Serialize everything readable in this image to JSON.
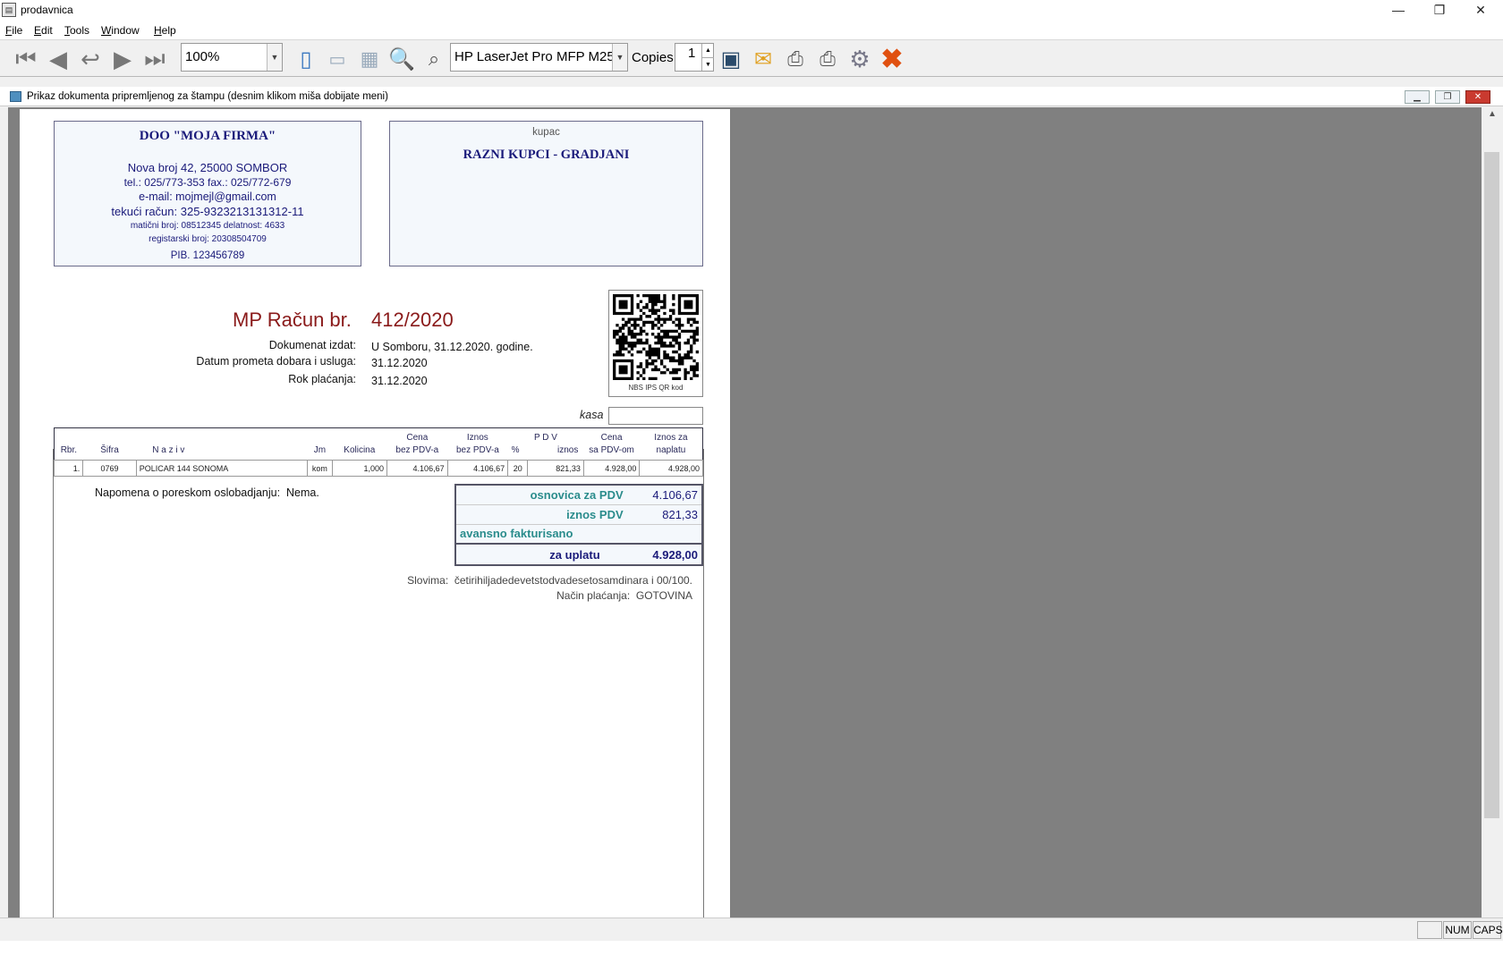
{
  "window": {
    "title": "prodavnica",
    "controls": {
      "minimize": "—",
      "restore": "❐",
      "close": "✕"
    }
  },
  "menu": [
    "File",
    "Edit",
    "Tools",
    "Window",
    "Help"
  ],
  "toolbar": {
    "zoom": "100%",
    "printer": "HP LaserJet Pro MFP M25-",
    "copies_label": "Copies",
    "copies_value": "1"
  },
  "doc_window": {
    "title": "Prikaz dokumenta pripremljenog za štampu  (desnim klikom miša dobijate meni)"
  },
  "seller": {
    "name": "DOO  \"MOJA FIRMA\"",
    "address": "Nova broj 42, 25000 SOMBOR",
    "phone": "tel.: 025/773-353  fax.: 025/772-679",
    "email": "e-mail: mojmejl@gmail.com",
    "account": "tekući račun:   325-9323213131312-11",
    "ids": "matični broj: 08512345  delatnost: 4633",
    "register": "registarski broj: 20308504709",
    "pib": "PIB. 123456789"
  },
  "buyer": {
    "label": "kupac",
    "name": "RAZNI KUPCI - GRADJANI"
  },
  "invoice": {
    "title": "MP Račun  br.",
    "number": "412/2020",
    "issued_label": "Dokumenat izdat:",
    "issued_value": "U Somboru, 31.12.2020. godine.",
    "turnover_label": "Datum prometa dobara i usluga:",
    "turnover_value": "31.12.2020",
    "due_label": "Rok plaćanja:",
    "due_value": "31.12.2020",
    "qr_caption": "NBS  IPS QR kod",
    "kasa_label": "kasa"
  },
  "table": {
    "headers": {
      "rbr": "Rbr.",
      "sifra": "Šifra",
      "naziv": "N a z i v",
      "jm": "Jm",
      "kolicina": "Kolicina",
      "cena1": "Cena",
      "cena2": "bez PDV-a",
      "iznos1": "Iznos",
      "iznos2": "bez PDV-a",
      "pdv": "P D V",
      "pdv_pct": "%",
      "pdv_iznos": "iznos",
      "cena_pdv1": "Cena",
      "cena_pdv2": "sa PDV-om",
      "naplata1": "Iznos za",
      "naplata2": "naplatu"
    },
    "rows": [
      {
        "rbr": "1.",
        "sifra": "0769",
        "naziv": "POLICAR 144 SONOMA",
        "jm": "kom",
        "kolicina": "1,000",
        "cena": "4.106,67",
        "iznos": "4.106,67",
        "pdv_pct": "20",
        "pdv_iznos": "821,33",
        "cena_pdv": "4.928,00",
        "naplata": "4.928,00"
      }
    ]
  },
  "note_label": "Napomena o poreskom oslobadjanju:",
  "note_value": "Nema.",
  "totals": {
    "osnovica_label": "osnovica za PDV",
    "osnovica_value": "4.106,67",
    "pdv_label": "iznos PDV",
    "pdv_value": "821,33",
    "avans_label": "avansno fakturisano",
    "uplata_label": "za uplatu",
    "uplata_value": "4.928,00"
  },
  "slovima_label": "Slovima:",
  "slovima_value": "četirihiljadedevetstodvadesetosamdinara i 00/100.",
  "nacin_label": "Način plaćanja:",
  "nacin_value": "GOTOVINA",
  "status": {
    "num": "NUM",
    "caps": "CAPS"
  }
}
